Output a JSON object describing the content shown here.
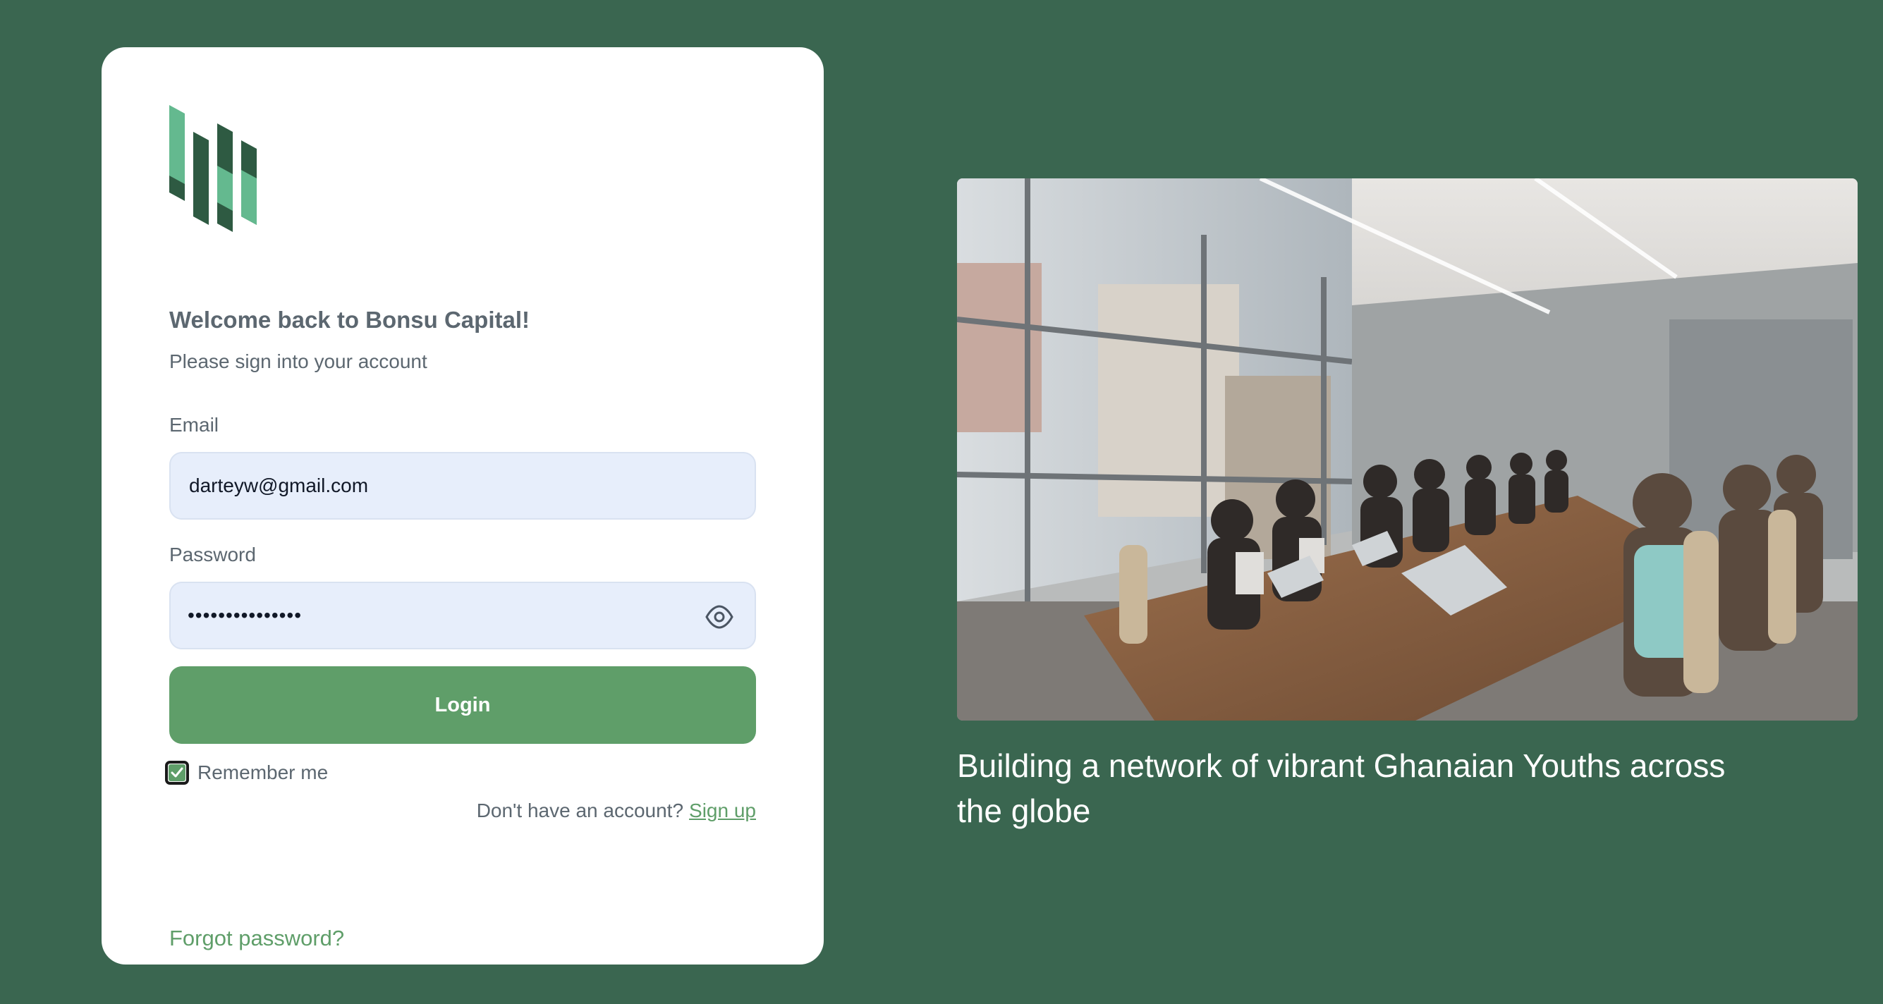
{
  "brand": {
    "colors": {
      "background": "#3a6650",
      "accent": "#5f9e69",
      "logo_light": "#64b98f",
      "logo_dark": "#2e5a42"
    }
  },
  "login": {
    "title": "Welcome back to Bonsu Capital!",
    "subtitle": "Please sign into your account",
    "email_label": "Email",
    "email_value": "darteyw@gmail.com",
    "password_label": "Password",
    "password_mask": "•••••••••••••••",
    "password_toggle_icon": "eye-icon",
    "login_button": "Login",
    "remember_label": "Remember me",
    "remember_checked": true,
    "no_account_text": "Don't have an account?",
    "signup_link": "Sign up",
    "forgot_password": "Forgot password?"
  },
  "hero": {
    "image_description_icon": "meeting-photo",
    "caption": "Building a network of vibrant Ghanaian Youths across the globe"
  }
}
